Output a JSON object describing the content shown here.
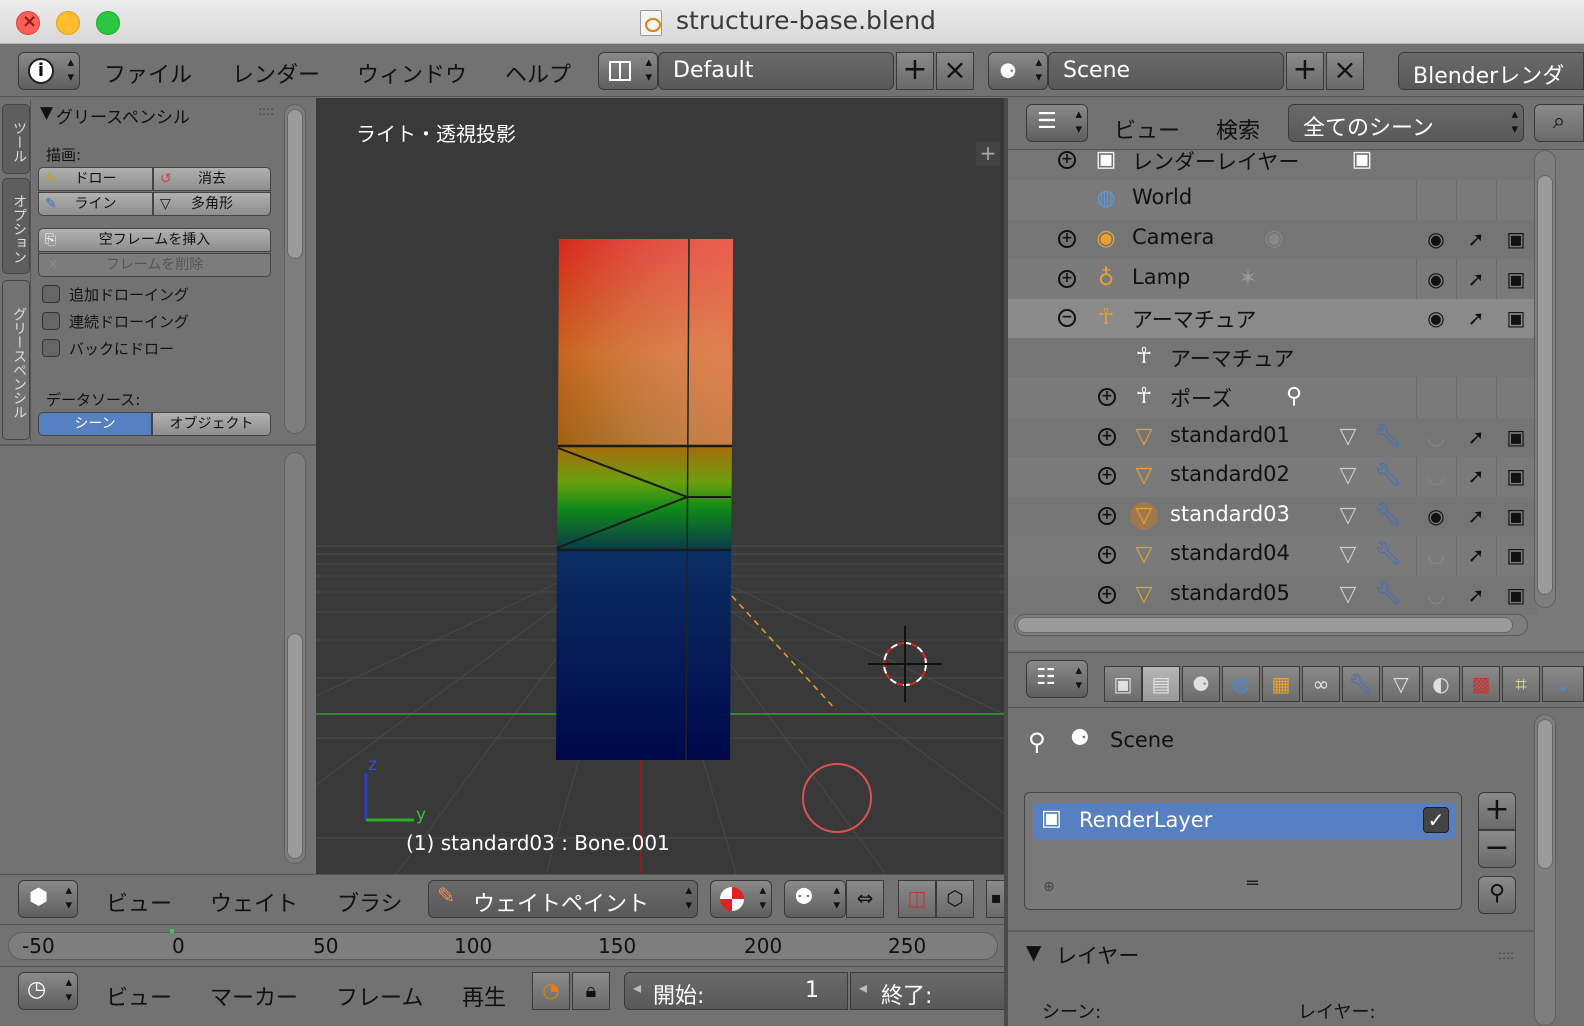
{
  "window": {
    "title": "structure-base.blend"
  },
  "topbar": {
    "menus": [
      "ファイル",
      "レンダー",
      "ウィンドウ",
      "ヘルプ"
    ],
    "screen_layout": "Default",
    "scene": "Scene",
    "render_engine": "Blenderレンダー"
  },
  "tool_shelf": {
    "tabs": [
      "ツール",
      "オプション",
      "グリースペンシル"
    ],
    "panel_title": "グリースペンシル",
    "draw_label": "描画:",
    "draw_buttons": [
      "ドロー",
      "消去",
      "ライン",
      "多角形"
    ],
    "insert_blank_frame": "空フレームを挿入",
    "delete_frame": "フレームを削除",
    "checkboxes": [
      "追加ドローイング",
      "連続ドローイング",
      "バックにドロー"
    ],
    "data_source_label": "データソース:",
    "data_source_options": [
      "シーン",
      "オブジェクト"
    ],
    "data_source_selected": "シーン"
  },
  "viewport": {
    "view_label": "ライト・透視投影",
    "status": "(1) standard03 : Bone.001",
    "axis_z": "z",
    "axis_y": "y"
  },
  "viewport_header": {
    "menus": [
      "ビュー",
      "ウェイト",
      "ブラシ"
    ],
    "mode": "ウェイトペイント"
  },
  "timeline": {
    "ticks": [
      "-50",
      "0",
      "50",
      "100",
      "150",
      "200",
      "250"
    ]
  },
  "timeline_header": {
    "menus": [
      "ビュー",
      "マーカー",
      "フレーム",
      "再生"
    ],
    "start_label": "開始:",
    "start_value": "1",
    "end_label": "終了:"
  },
  "outliner": {
    "menus": [
      "ビュー",
      "検索"
    ],
    "filter": "全てのシーン",
    "rows": [
      {
        "name": "レンダーレイヤー",
        "icon": "render-layers-icon"
      },
      {
        "name": "World",
        "icon": "world-icon"
      },
      {
        "name": "Camera",
        "icon": "camera-icon"
      },
      {
        "name": "Lamp",
        "icon": "lamp-icon"
      },
      {
        "name": "アーマチュア",
        "icon": "armature-icon"
      },
      {
        "name": "アーマチュア",
        "icon": "armature-data-icon"
      },
      {
        "name": "ポーズ",
        "icon": "pose-icon"
      },
      {
        "name": "standard01",
        "icon": "mesh-icon"
      },
      {
        "name": "standard02",
        "icon": "mesh-icon"
      },
      {
        "name": "standard03",
        "icon": "mesh-icon"
      },
      {
        "name": "standard04",
        "icon": "mesh-icon"
      },
      {
        "name": "standard05",
        "icon": "mesh-icon"
      }
    ]
  },
  "properties": {
    "context": "Scene",
    "render_layer": "RenderLayer",
    "layer_panel_title": "レイヤー",
    "bottom_labels": [
      "シーン:",
      "レイヤー:"
    ]
  },
  "colors": {
    "selection_blue": "#5680c2",
    "blender_orange": "#e87d0d",
    "viewport_bg": "#393939"
  }
}
